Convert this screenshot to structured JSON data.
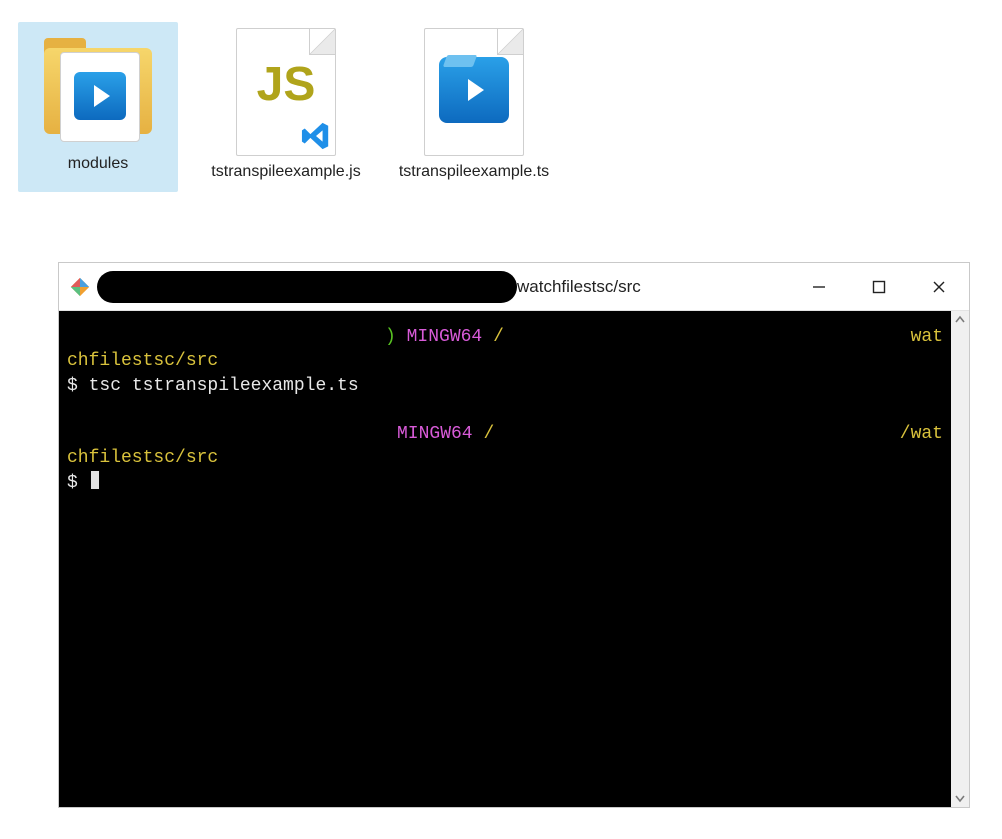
{
  "explorer": {
    "items": [
      {
        "label": "modules",
        "selected": true,
        "kind": "folder"
      },
      {
        "label": "tstranspileexample.js",
        "selected": false,
        "kind": "js"
      },
      {
        "label": "tstranspileexample.ts",
        "selected": false,
        "kind": "ts"
      }
    ]
  },
  "terminal_window": {
    "title_path": "watchfilestsc/src",
    "controls": {
      "min": "–",
      "max": "▢",
      "close": "✕"
    }
  },
  "terminal": {
    "lines": [
      {
        "branchEnd": ")",
        "mingw": "MINGW64",
        "pathPrefix": "/",
        "rightTail": "wat"
      },
      {
        "cwd": "chfilestsc/src"
      },
      {
        "prompt": "$ ",
        "cmd": "tsc tstranspileexample.ts"
      },
      {
        "blank": true
      },
      {
        "branchEnd": "",
        "mingw": "MINGW64",
        "pathPrefix": "/",
        "rightTail": "/wat"
      },
      {
        "cwd": "chfilestsc/src"
      },
      {
        "prompt": "$ ",
        "cursor": true
      }
    ]
  }
}
